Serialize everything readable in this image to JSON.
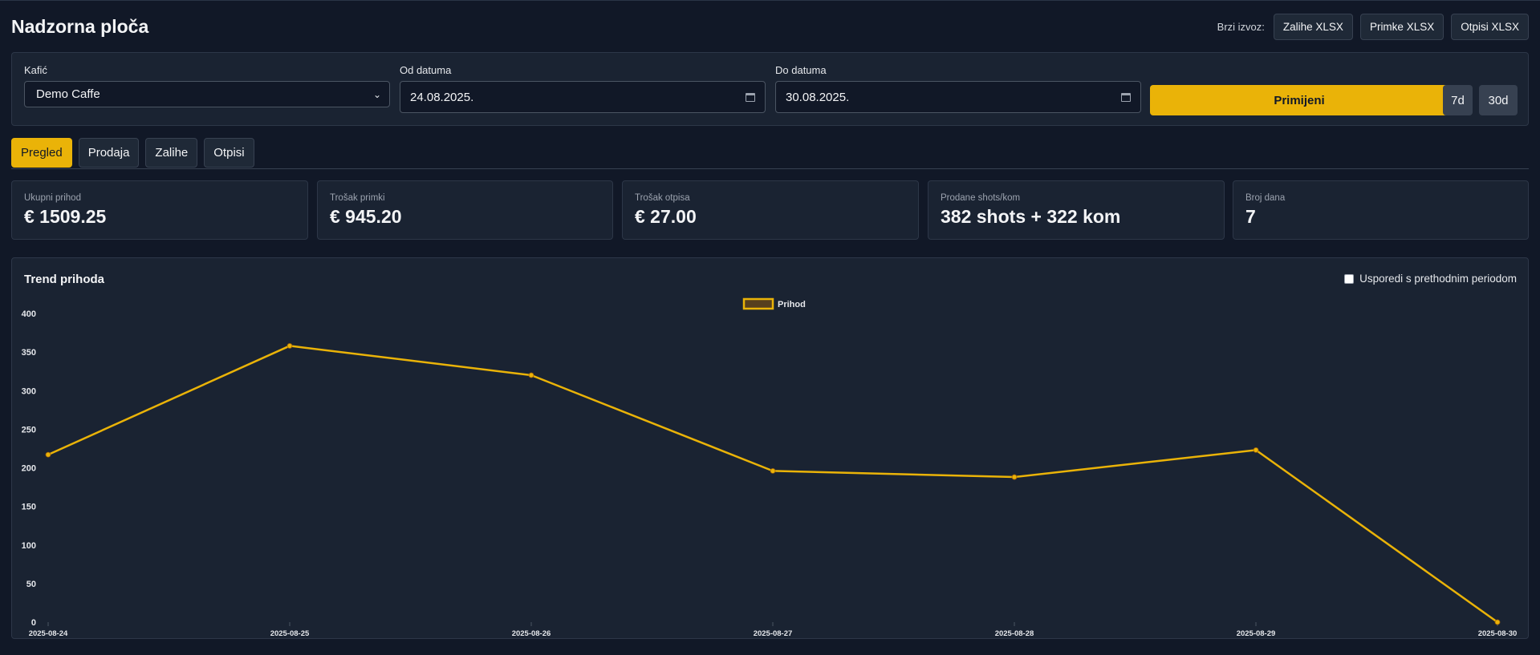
{
  "header": {
    "title": "Nadzorna ploča",
    "export_label": "Brzi izvoz:",
    "export_buttons": [
      "Zalihe XLSX",
      "Primke XLSX",
      "Otpisi XLSX"
    ]
  },
  "filters": {
    "cafe_label": "Kafić",
    "cafe_value": "Demo Caffe",
    "from_label": "Od datuma",
    "from_value": "24.08.2025.",
    "to_label": "Do datuma",
    "to_value": "30.08.2025.",
    "apply_label": "Primijeni",
    "range_7d": "7d",
    "range_30d": "30d"
  },
  "tabs": [
    {
      "label": "Pregled",
      "active": true
    },
    {
      "label": "Prodaja",
      "active": false
    },
    {
      "label": "Zalihe",
      "active": false
    },
    {
      "label": "Otpisi",
      "active": false
    }
  ],
  "stats": [
    {
      "label": "Ukupni prihod",
      "value": "€ 1509.25"
    },
    {
      "label": "Trošak primki",
      "value": "€ 945.20"
    },
    {
      "label": "Trošak otpisa",
      "value": "€ 27.00"
    },
    {
      "label": "Prodane shots/kom",
      "value": "382 shots + 322 kom"
    },
    {
      "label": "Broj dana",
      "value": "7"
    }
  ],
  "trend": {
    "title": "Trend prihoda",
    "compare_label": "Usporedi s prethodnim periodom",
    "compare_checked": false
  },
  "colors": {
    "accent": "#eab308",
    "background": "#111827",
    "card": "#1a2332"
  },
  "chart_data": {
    "type": "line",
    "x": [
      "2025-08-24",
      "2025-08-25",
      "2025-08-26",
      "2025-08-27",
      "2025-08-28",
      "2025-08-29",
      "2025-08-30"
    ],
    "series": [
      {
        "name": "Prihod",
        "values": [
          217,
          358,
          320,
          196,
          188,
          223,
          0
        ],
        "color": "#eab308"
      }
    ],
    "ylim": [
      0,
      400
    ],
    "yticks": [
      0,
      50,
      100,
      150,
      200,
      250,
      300,
      350,
      400
    ],
    "legend": "top-center",
    "grid": false
  }
}
